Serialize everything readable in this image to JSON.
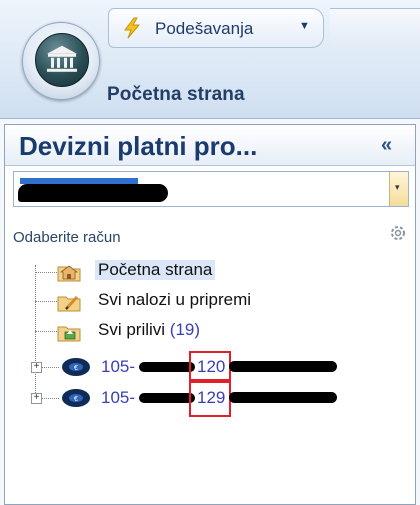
{
  "ribbon": {
    "app_menu_icon": "bank-icon",
    "quick_access": {
      "icon": "lightning-icon",
      "label": "Podešavanja",
      "arrow": "▼"
    },
    "home_tab": "Početna strana"
  },
  "nav_pane": {
    "title": "Devizni platni pro...",
    "collapse": "«",
    "account_combo": {
      "value": "",
      "dropdown_icon": "▾"
    },
    "select_label": "Odaberite račun",
    "options_icon": "gear-icon",
    "tree": [
      {
        "label": "Početna strana",
        "icon": "home-folder-icon",
        "selected": true
      },
      {
        "label": "Svi nalozi u pripremi",
        "icon": "edit-folder-icon"
      },
      {
        "label": "Svi prilivi",
        "count": "(19)",
        "icon": "inbox-folder-icon"
      }
    ],
    "accounts": [
      {
        "prefix": "105-",
        "visible_part": "120",
        "expander": "+",
        "icon": "currency-icon"
      },
      {
        "prefix": "105-",
        "visible_part": "129",
        "expander": "+",
        "icon": "currency-icon"
      }
    ]
  }
}
